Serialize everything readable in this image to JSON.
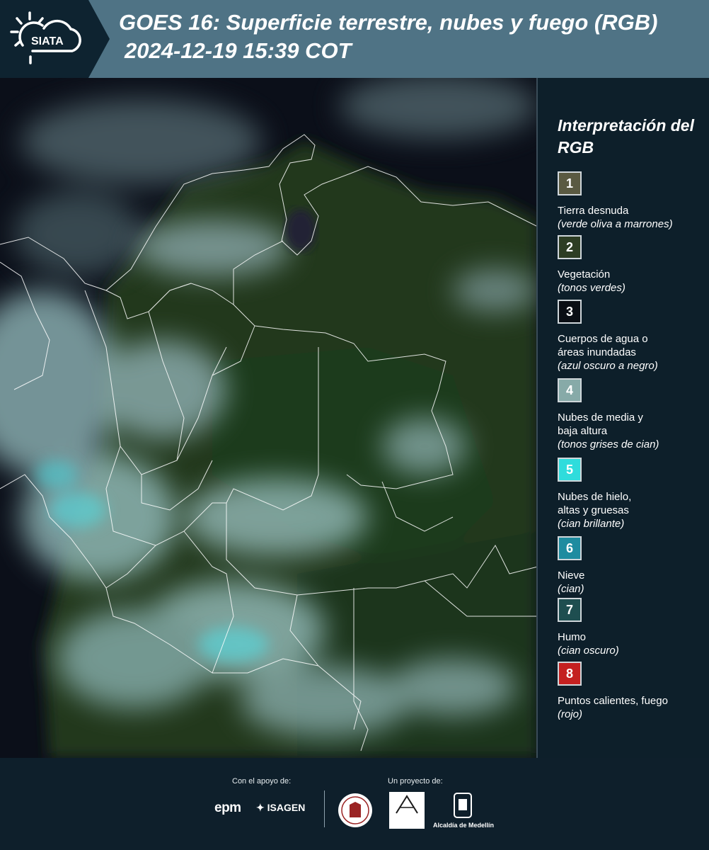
{
  "header": {
    "logo_text": "SIATA",
    "title_line1": "GOES 16: Superficie terrestre, nubes y fuego (RGB)",
    "title_line2": "2024-12-19 15:39 COT"
  },
  "legend": {
    "title": "Interpretación del RGB",
    "items": [
      {
        "number": "1",
        "label": "Tierra desnuda",
        "sub": "(verde oliva a marrones)",
        "color": "#5a5a42"
      },
      {
        "number": "2",
        "label": "Vegetación",
        "sub": "(tonos verdes)",
        "color": "#2d3d23"
      },
      {
        "number": "3",
        "label": "Cuerpos de agua o\náreas inundadas",
        "sub": "(azul oscuro a negro)",
        "color": "#0a0e14"
      },
      {
        "number": "4",
        "label": "Nubes de media y\nbaja altura",
        "sub": "(tonos grises de cian)",
        "color": "#87aaa8"
      },
      {
        "number": "5",
        "label": "Nubes de hielo,\naltas y gruesas",
        "sub": "(cian brillante)",
        "color": "#2fdcdc"
      },
      {
        "number": "6",
        "label": "Nieve",
        "sub": "(cian)",
        "color": "#1e8ca0"
      },
      {
        "number": "7",
        "label": "Humo",
        "sub": "(cian oscuro)",
        "color": "#1e4e50"
      },
      {
        "number": "8",
        "label": "Puntos calientes, fuego",
        "sub": "(rojo)",
        "color": "#c42020"
      }
    ]
  },
  "footer": {
    "support_caption": "Con el apoyo de:",
    "project_caption": "Un proyecto de:",
    "epm": "epm",
    "isagen": "ISAGEN",
    "alcaldia": "Alcaldía de Medellín"
  }
}
